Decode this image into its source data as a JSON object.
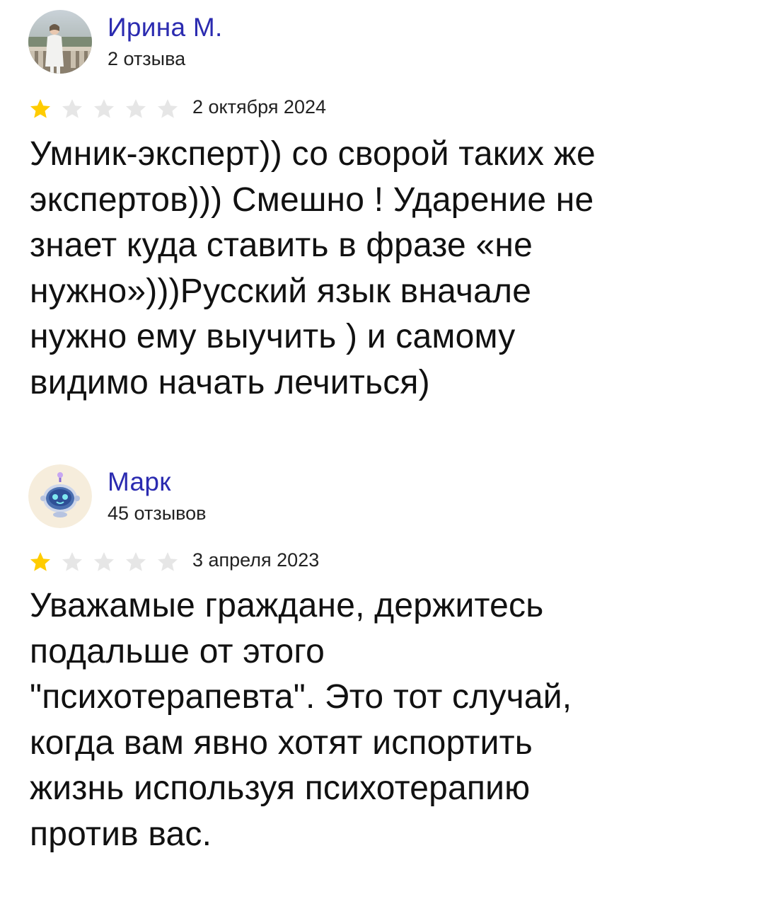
{
  "reviews": [
    {
      "author": "Ирина М.",
      "review_count": "2 отзыва",
      "rating": 1,
      "rating_max": 5,
      "date": "2 октября 2024",
      "text_lines": [
        "Умник-эксперт)) со сворой таких же",
        "экспертов))) Смешно ! Ударение не",
        "знает куда ставить в фразе «не",
        "нужно»)))Русский язык вначале",
        "нужно ему выучить ) и самому",
        "видимо начать лечиться)"
      ],
      "avatar_icon": "user-photo-icon"
    },
    {
      "author": "Марк",
      "review_count": "45 отзывов",
      "rating": 1,
      "rating_max": 5,
      "date": "3 апреля 2023",
      "text_lines": [
        "Уважамые граждане, держитесь",
        "подальше от этого",
        "\"психотерапевта\". Это тот случай,",
        "когда вам явно хотят испортить",
        "жизнь используя психотерапию",
        "против вас."
      ],
      "avatar_icon": "robot-avatar-icon"
    }
  ],
  "colors": {
    "author_name": "#2b2bb0",
    "star_filled": "#fc0",
    "star_empty": "#e6e6e6"
  }
}
